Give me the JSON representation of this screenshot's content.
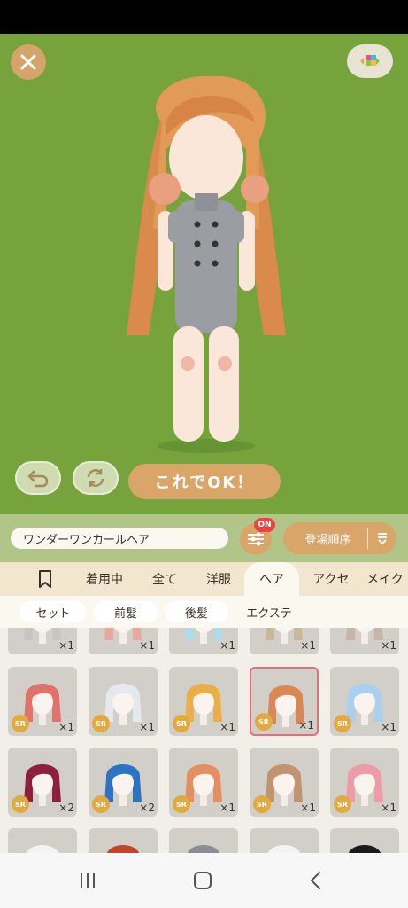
{
  "stage": {
    "background": "#76a33b",
    "ok_label": "これでOK！"
  },
  "toolbar": {
    "item_name": "ワンダーワンカールヘア",
    "filter_badge": "ON",
    "sort_label": "登場順序"
  },
  "tabs": [
    {
      "label": "",
      "icon": "bookmark-icon"
    },
    {
      "label": "着用中"
    },
    {
      "label": "全て"
    },
    {
      "label": "洋服"
    },
    {
      "label": "ヘア",
      "active": true
    },
    {
      "label": "アクセ"
    },
    {
      "label": "メイク"
    }
  ],
  "subtabs": [
    {
      "label": "セット",
      "active": true
    },
    {
      "label": "前髪",
      "active": true
    },
    {
      "label": "後髪",
      "active": true
    },
    {
      "label": "エクステ"
    }
  ],
  "grid": {
    "rarity_label": "SR",
    "rows": [
      [
        {
          "count": "×1",
          "hair": "#c9c6c2"
        },
        {
          "count": "×1",
          "hair": "#e9a7a0"
        },
        {
          "count": "×1",
          "hair": "#aedbea"
        },
        {
          "count": "×1",
          "hair": "#c7b79c"
        },
        {
          "count": "×1",
          "hair": "#c9b5a8"
        }
      ],
      [
        {
          "count": "×1",
          "hair": "#e0726b",
          "rarity": true
        },
        {
          "count": "×1",
          "hair": "#e6e8ef",
          "rarity": true
        },
        {
          "count": "×1",
          "hair": "#e9b04a",
          "rarity": true
        },
        {
          "count": "×1",
          "hair": "#d98755",
          "rarity": true,
          "selected": true
        },
        {
          "count": "×1",
          "hair": "#a9d0ef",
          "rarity": true
        }
      ],
      [
        {
          "count": "×2",
          "hair": "#8e1f3f",
          "rarity": true
        },
        {
          "count": "×2",
          "hair": "#2b74c4",
          "rarity": true
        },
        {
          "count": "×1",
          "hair": "#e38f61",
          "rarity": true
        },
        {
          "count": "×1",
          "hair": "#c09371",
          "rarity": true
        },
        {
          "count": "×1",
          "hair": "#ec9ca6",
          "rarity": true
        }
      ],
      [
        {
          "count": "",
          "hair": "#f3f3f3"
        },
        {
          "count": "",
          "hair": "#c4452e"
        },
        {
          "count": "",
          "hair": "#8a8d92"
        },
        {
          "count": "",
          "hair": "#f4f4f4"
        },
        {
          "count": "",
          "hair": "#1b1b1b"
        }
      ]
    ]
  },
  "icons": [
    "close-icon",
    "layout-icon",
    "undo-icon",
    "rotate-icon",
    "filter-icon",
    "sort-icon",
    "bookmark-icon",
    "recents-icon",
    "home-icon",
    "back-icon"
  ]
}
